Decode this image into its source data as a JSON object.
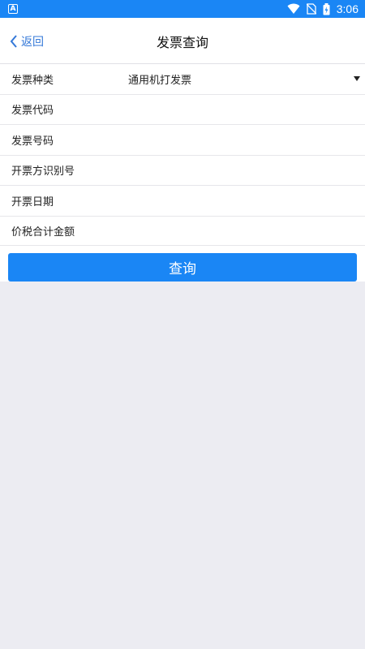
{
  "status_bar": {
    "notification_icon": "A",
    "time": "3:06",
    "icons": [
      "wifi-icon",
      "no-sim-icon",
      "battery-charging-icon"
    ]
  },
  "header": {
    "back_label": "返回",
    "title": "发票查询"
  },
  "form": {
    "invoice_type": {
      "label": "发票种类",
      "value": "通用机打发票"
    },
    "invoice_code": {
      "label": "发票代码",
      "value": ""
    },
    "invoice_number": {
      "label": "发票号码",
      "value": ""
    },
    "taxpayer_id": {
      "label": "开票方识别号",
      "value": ""
    },
    "invoice_date": {
      "label": "开票日期",
      "value": ""
    },
    "total_amount": {
      "label": "价税合计金额",
      "value": ""
    }
  },
  "query_button": {
    "label": "查询"
  },
  "colors": {
    "accent": "#1a86f5",
    "back_link": "#3478d8",
    "background": "#ececf2"
  }
}
